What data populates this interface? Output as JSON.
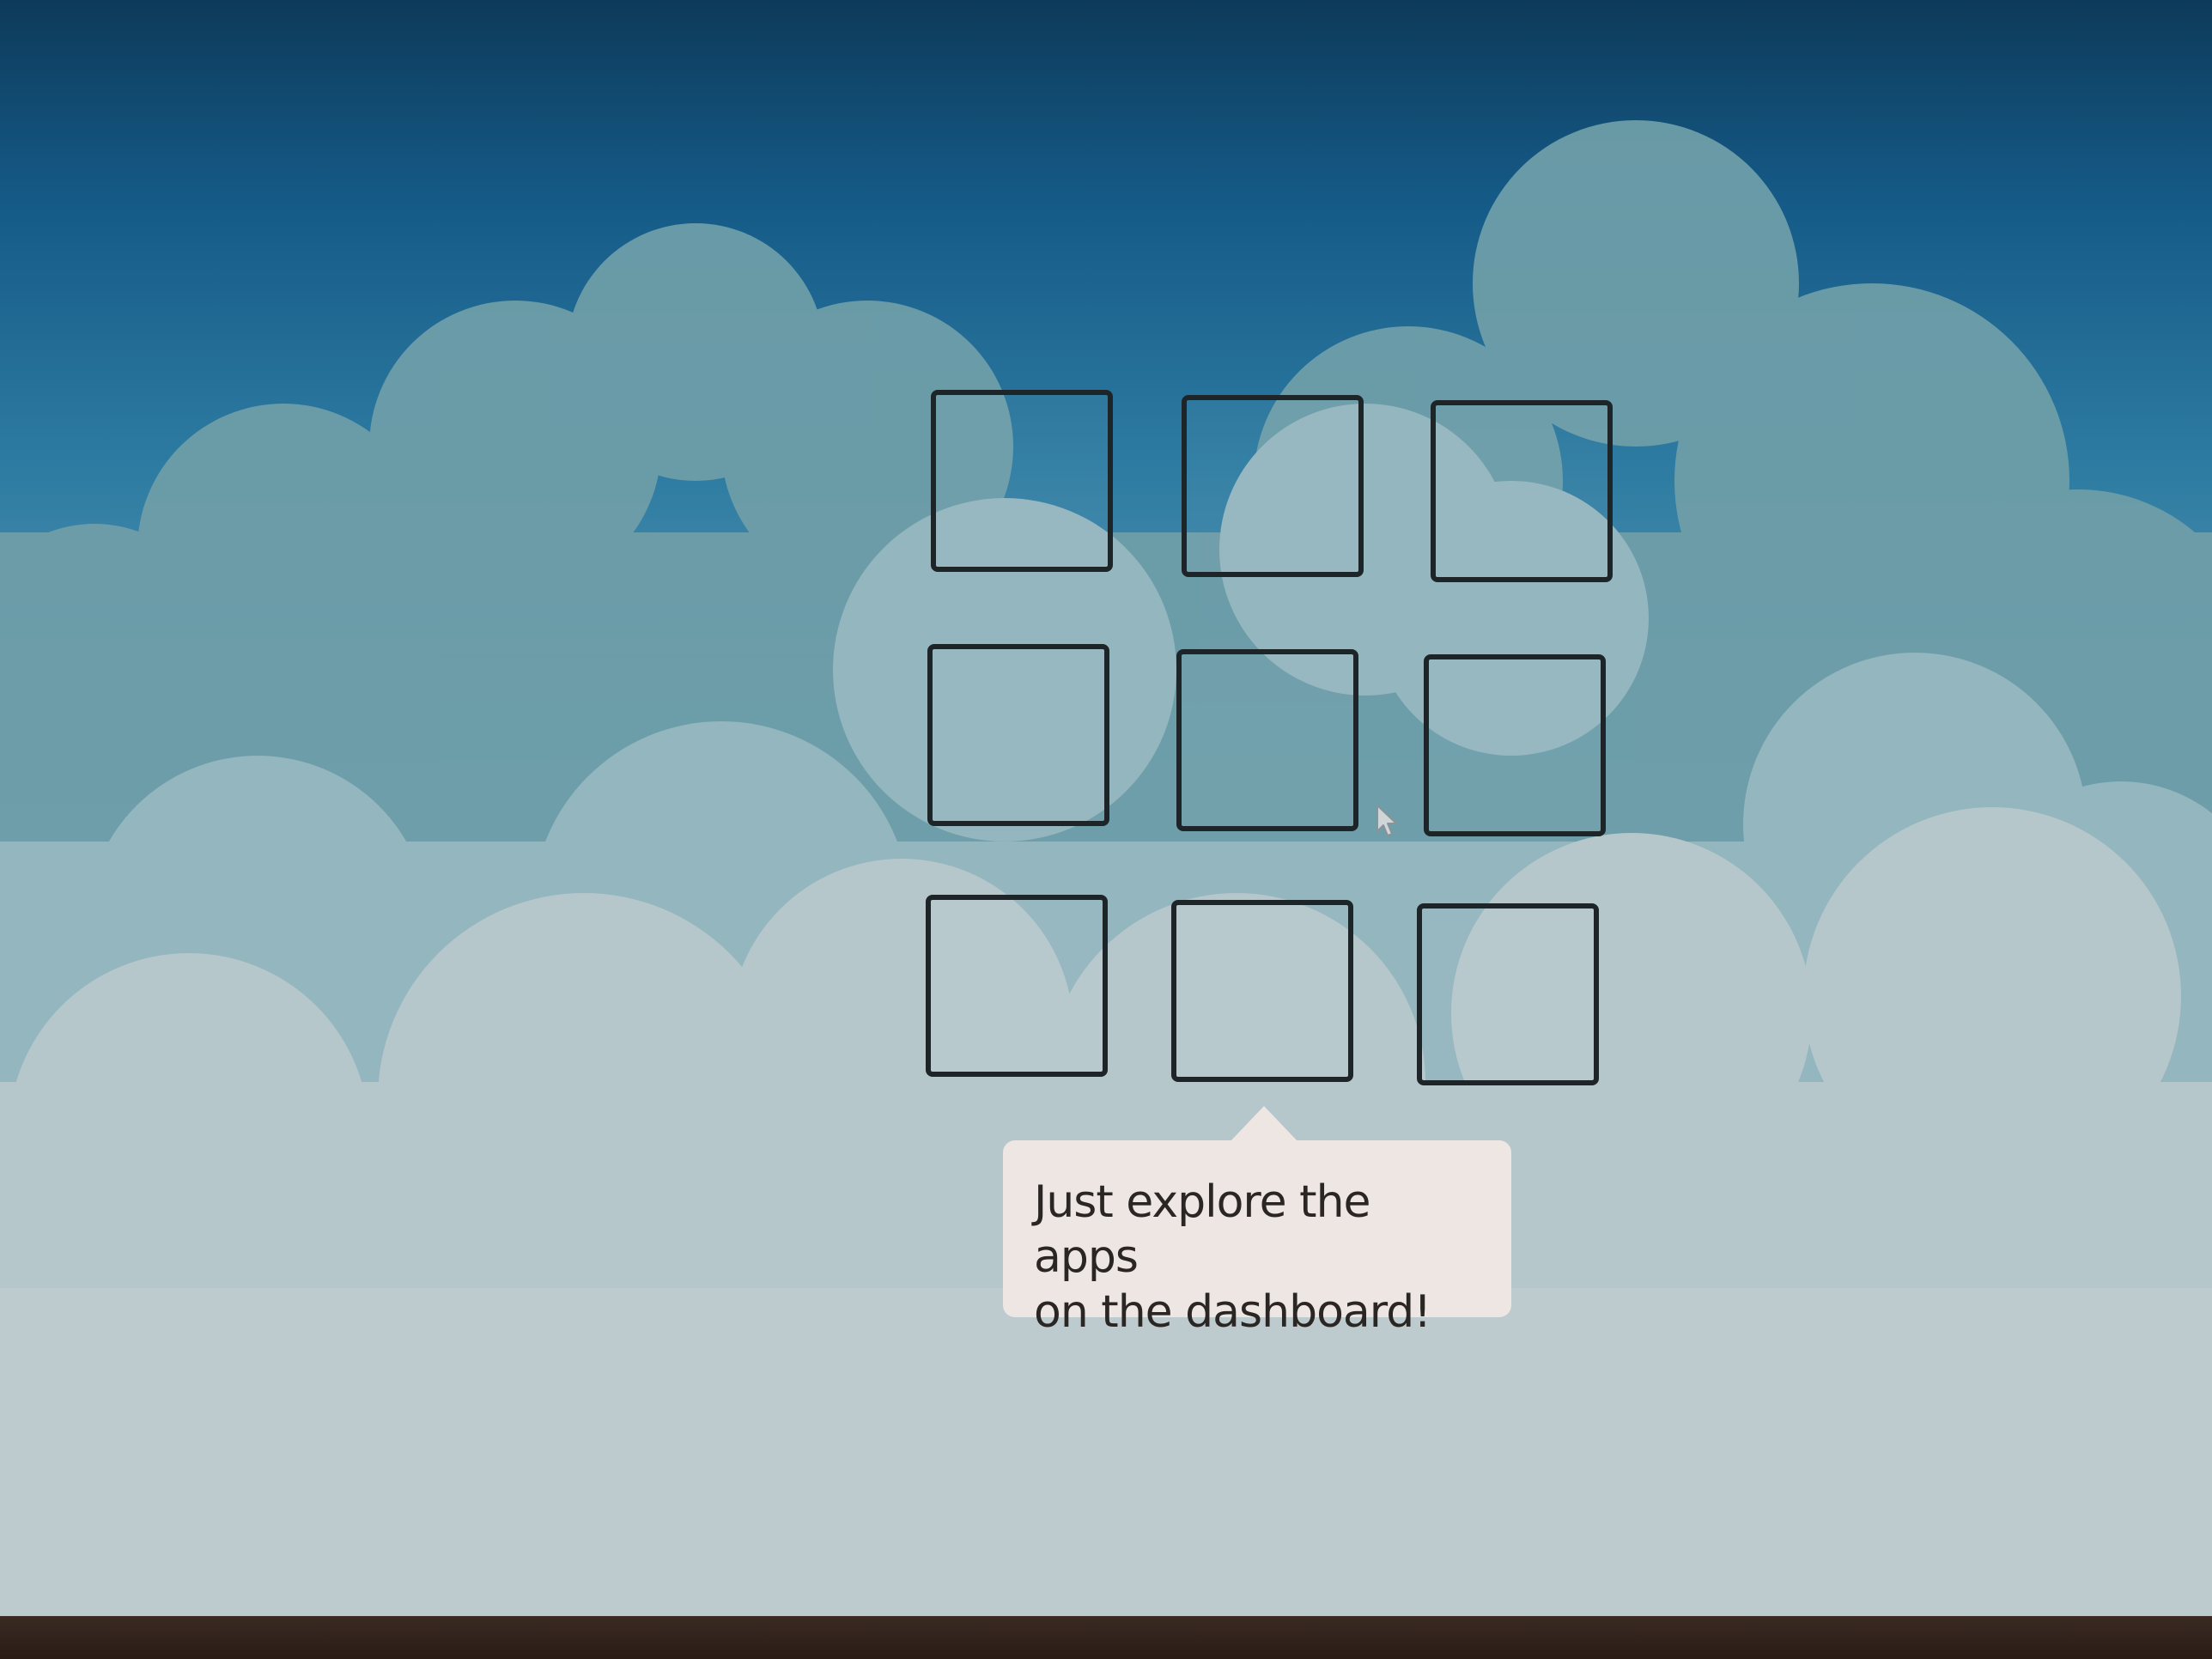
{
  "screen": {
    "background_colors": {
      "sky_top": "#0d3a5a",
      "sky_mid": "#2d7ba2",
      "cloud_back": "#6e9ea9",
      "cloud_front": "#b8c9cd"
    }
  },
  "dashboard_grid": {
    "rows": 3,
    "columns": 3,
    "tile_border_color": "#1e2528",
    "tiles": [
      {
        "name": "app-tile-1"
      },
      {
        "name": "app-tile-2"
      },
      {
        "name": "app-tile-3"
      },
      {
        "name": "app-tile-4"
      },
      {
        "name": "app-tile-5"
      },
      {
        "name": "app-tile-6"
      },
      {
        "name": "app-tile-7"
      },
      {
        "name": "app-tile-8"
      },
      {
        "name": "app-tile-9"
      }
    ]
  },
  "tooltip": {
    "line1": "Just explore the apps",
    "line2": "on the dashboard!",
    "background": "#ede6e3"
  },
  "cursor": {
    "icon": "mouse-pointer-icon"
  }
}
